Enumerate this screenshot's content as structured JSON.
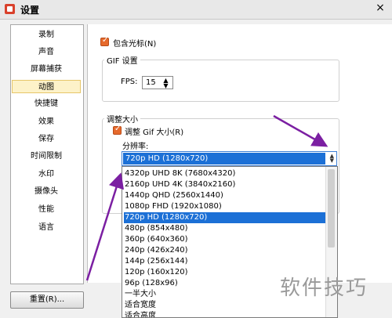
{
  "window": {
    "title": "设置",
    "close": "×"
  },
  "sidebar": {
    "items": [
      {
        "label": "录制"
      },
      {
        "label": "声音"
      },
      {
        "label": "屏幕捕获"
      },
      {
        "label": "动图"
      },
      {
        "label": "快捷键"
      },
      {
        "label": "效果"
      },
      {
        "label": "保存"
      },
      {
        "label": "时间限制"
      },
      {
        "label": "水印"
      },
      {
        "label": "摄像头"
      },
      {
        "label": "性能"
      },
      {
        "label": "语言"
      }
    ],
    "selected_index": 3
  },
  "reset_button": "重置(R)...",
  "include_cursor": {
    "label": "包含光标(N)",
    "checked": true
  },
  "gif_settings": {
    "group_title": "GIF 设置",
    "fps_label": "FPS:",
    "fps_value": "15"
  },
  "resize": {
    "group_title": "调整大小",
    "checkbox_label": "调整 Gif 大小(R)",
    "checked": true,
    "resolution_label": "分辨率:",
    "selected": "720p HD (1280x720)",
    "options": [
      "4320p UHD 8K (7680x4320)",
      "2160p UHD 4K (3840x2160)",
      "1440p QHD (2560x1440)",
      "1080p FHD (1920x1080)",
      "720p HD (1280x720)",
      "480p (854x480)",
      "360p (640x360)",
      "240p (426x240)",
      "144p (256x144)",
      "120p (160x120)",
      "96p (128x96)",
      "一半大小",
      "适合宽度",
      "适合高度"
    ]
  },
  "watermark": "软件技巧",
  "colors": {
    "accent": "#1c70d6",
    "checkbox": "#e66a2c",
    "annotation_arrow": "#7b1fa2"
  }
}
